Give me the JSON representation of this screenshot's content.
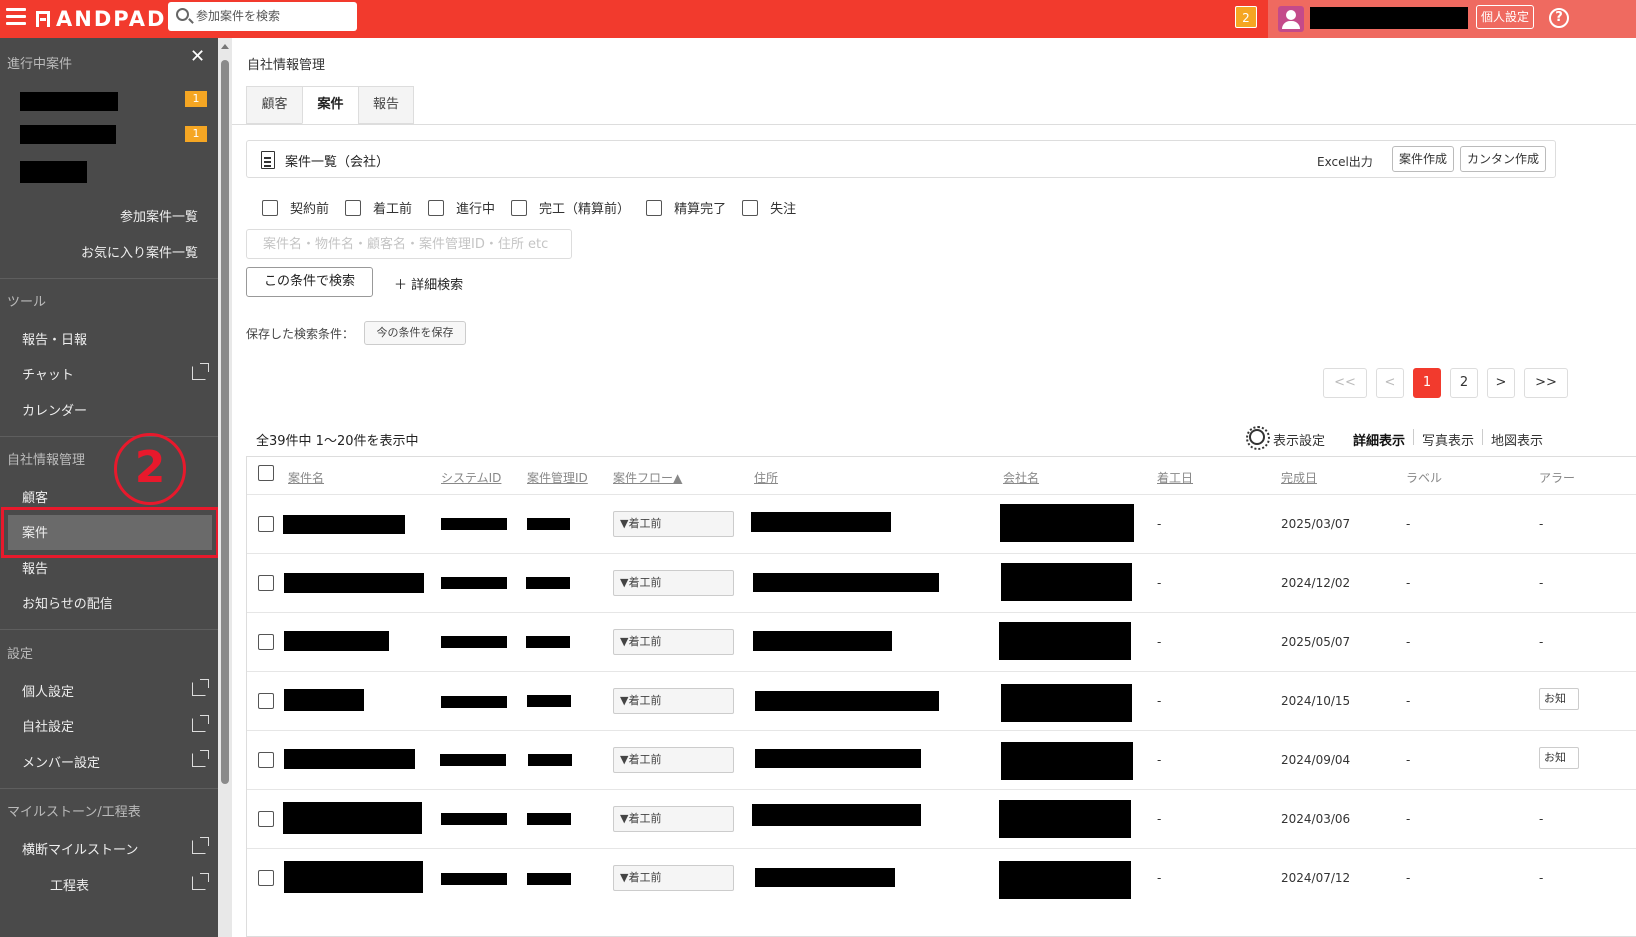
{
  "topbar": {
    "logo": "ANDPAD",
    "search_placeholder": "参加案件を検索",
    "notification_count": "2",
    "personal_settings": "個人設定",
    "help": "?"
  },
  "sidebar": {
    "section_ongoing": "進行中案件",
    "close": "✕",
    "badges": [
      "1",
      "1"
    ],
    "participating_list": "参加案件一覧",
    "favorite_list": "お気に入り案件一覧",
    "section_tools": "ツール",
    "tools": [
      "報告・日報",
      "チャット",
      "カレンダー"
    ],
    "section_company": "自社情報管理",
    "company": [
      "顧客",
      "案件",
      "報告",
      "お知らせの配信"
    ],
    "section_settings": "設定",
    "settings": [
      "個人設定",
      "自社設定",
      "メンバー設定"
    ],
    "section_milestone": "マイルストーン/工程表",
    "milestone": [
      "横断マイルストーン",
      "工程表"
    ],
    "step_marker": "2"
  },
  "main": {
    "page_title": "自社情報管理",
    "tabs": [
      "顧客",
      "案件",
      "報告"
    ],
    "list_title": "案件一覧（会社）",
    "excel": "Excel出力",
    "create_project": "案件作成",
    "easy_create": "カンタン作成",
    "filters": [
      "契約前",
      "着工前",
      "進行中",
      "完工（精算前）",
      "精算完了",
      "失注"
    ],
    "search_placeholder": "案件名・物件名・顧客名・案件管理ID・住所 etc",
    "search_button": "この条件で検索",
    "detail_search": "＋ 詳細検索",
    "saved_label": "保存した検索条件：",
    "save_button": "今の条件を保存",
    "pager": [
      "<<",
      "<",
      "1",
      "2",
      ">",
      ">>"
    ],
    "count_text": "全39件中 1〜20件を表示中",
    "display_settings": "表示設定",
    "views": [
      "詳細表示",
      "写真表示",
      "地図表示"
    ],
    "columns": [
      "案件名",
      "システムID",
      "案件管理ID",
      "案件フロー▲",
      "住所",
      "会社名",
      "着工日",
      "完成日",
      "ラベル",
      "アラー"
    ],
    "flow_label": "▼着工前",
    "rows": [
      {
        "start": "-",
        "complete": "2025/03/07",
        "label": "-",
        "alert": "-"
      },
      {
        "start": "-",
        "complete": "2024/12/02",
        "label": "-",
        "alert": "-"
      },
      {
        "start": "-",
        "complete": "2025/05/07",
        "label": "-",
        "alert": "-"
      },
      {
        "start": "-",
        "complete": "2024/10/15",
        "label": "-",
        "alert": "お知"
      },
      {
        "start": "-",
        "complete": "2024/09/04",
        "label": "-",
        "alert": "お知"
      },
      {
        "start": "-",
        "complete": "2024/03/06",
        "label": "-",
        "alert": "-"
      },
      {
        "start": "-",
        "complete": "2024/07/12",
        "label": "-",
        "alert": "-"
      }
    ]
  }
}
